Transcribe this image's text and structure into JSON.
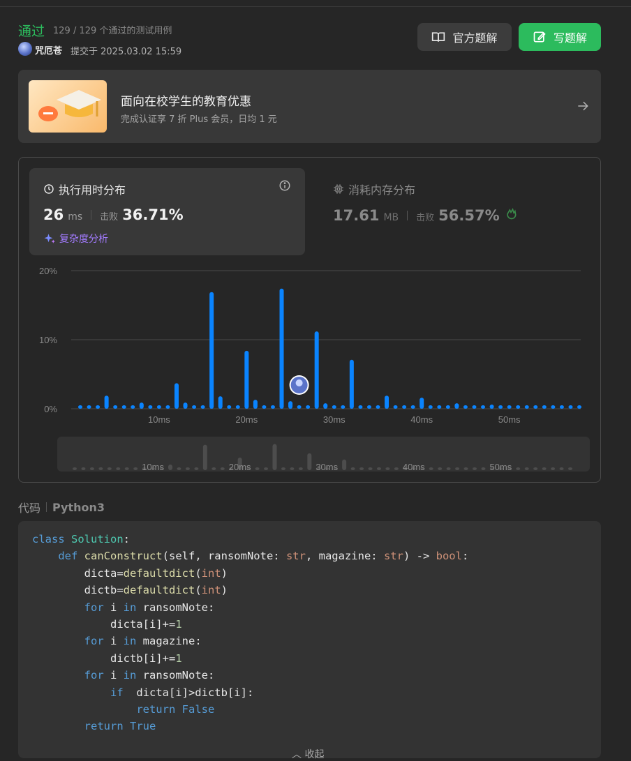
{
  "result": {
    "status": "通过",
    "passed_cases": "129 / 129 个通过的测试用例",
    "username": "咒厄苍",
    "submitted_at": "提交于 2025.03.02 15:59"
  },
  "actions": {
    "official_solution": "官方题解",
    "write_solution": "写题解"
  },
  "promo": {
    "title": "面向在校学生的教育优惠",
    "subtitle": "完成认证享 7 折 Plus 会员，日均 1 元"
  },
  "runtime": {
    "title": "执行用时分布",
    "value": "26",
    "unit": "ms",
    "beats_label": "击败",
    "beats_value": "36.71%",
    "complexity": "复杂度分析"
  },
  "memory": {
    "title": "消耗内存分布",
    "value": "17.61",
    "unit": "MB",
    "beats_label": "击败",
    "beats_value": "56.57%"
  },
  "chart_data": {
    "type": "bar",
    "x": [
      1,
      2,
      3,
      4,
      5,
      6,
      7,
      8,
      9,
      10,
      11,
      12,
      13,
      14,
      15,
      16,
      17,
      18,
      19,
      20,
      21,
      22,
      23,
      24,
      25,
      26,
      27,
      28,
      29,
      30,
      31,
      32,
      33,
      34,
      35,
      36,
      37,
      38,
      39,
      40,
      41,
      42,
      43,
      44,
      45,
      46,
      47,
      48,
      49,
      50,
      51,
      52,
      53,
      54,
      55,
      56,
      57,
      58
    ],
    "values": [
      0.5,
      0.5,
      0.5,
      1.9,
      0.5,
      0.5,
      0.5,
      0.9,
      0.5,
      0.5,
      0.5,
      3.7,
      0.9,
      0.5,
      0.5,
      16.9,
      1.8,
      0.5,
      0.5,
      8.4,
      1.3,
      0.5,
      0.5,
      17.4,
      1.1,
      0.5,
      0.5,
      11.2,
      0.8,
      0.5,
      0.5,
      7.1,
      0.5,
      0.5,
      0.5,
      1.9,
      0.5,
      0.5,
      0.5,
      1.6,
      0.5,
      0.5,
      0.5,
      0.8,
      0.5,
      0.5,
      0.5,
      0.6,
      0.5,
      0.5,
      0.5,
      0.5,
      0.5,
      0.5,
      0.5,
      0.5,
      0.5,
      0.5
    ],
    "y_ticks": [
      "20%",
      "10%",
      "0%"
    ],
    "ylim": [
      0,
      20
    ],
    "x_ticks": [
      "10ms",
      "20ms",
      "30ms",
      "40ms",
      "50ms"
    ],
    "highlight_x": 26,
    "grid": true,
    "color": "#0a84ff"
  },
  "code": {
    "label": "代码",
    "language": "Python3",
    "lines": [
      "class Solution:",
      "    def canConstruct(self, ransomNote: str, magazine: str) -> bool:",
      "        dicta=defaultdict(int)",
      "        dictb=defaultdict(int)",
      "        for i in ransomNote:",
      "            dicta[i]+=1",
      "        for i in magazine:",
      "            dictb[i]+=1",
      "        for i in ransomNote:",
      "            if  dicta[i]>dictb[i]:",
      "                return False",
      "        return True"
    ],
    "collapse_label": "收起"
  },
  "colors": {
    "accent_green": "#2cbb5d",
    "bar_blue": "#0a84ff",
    "purple": "#a37bff"
  }
}
